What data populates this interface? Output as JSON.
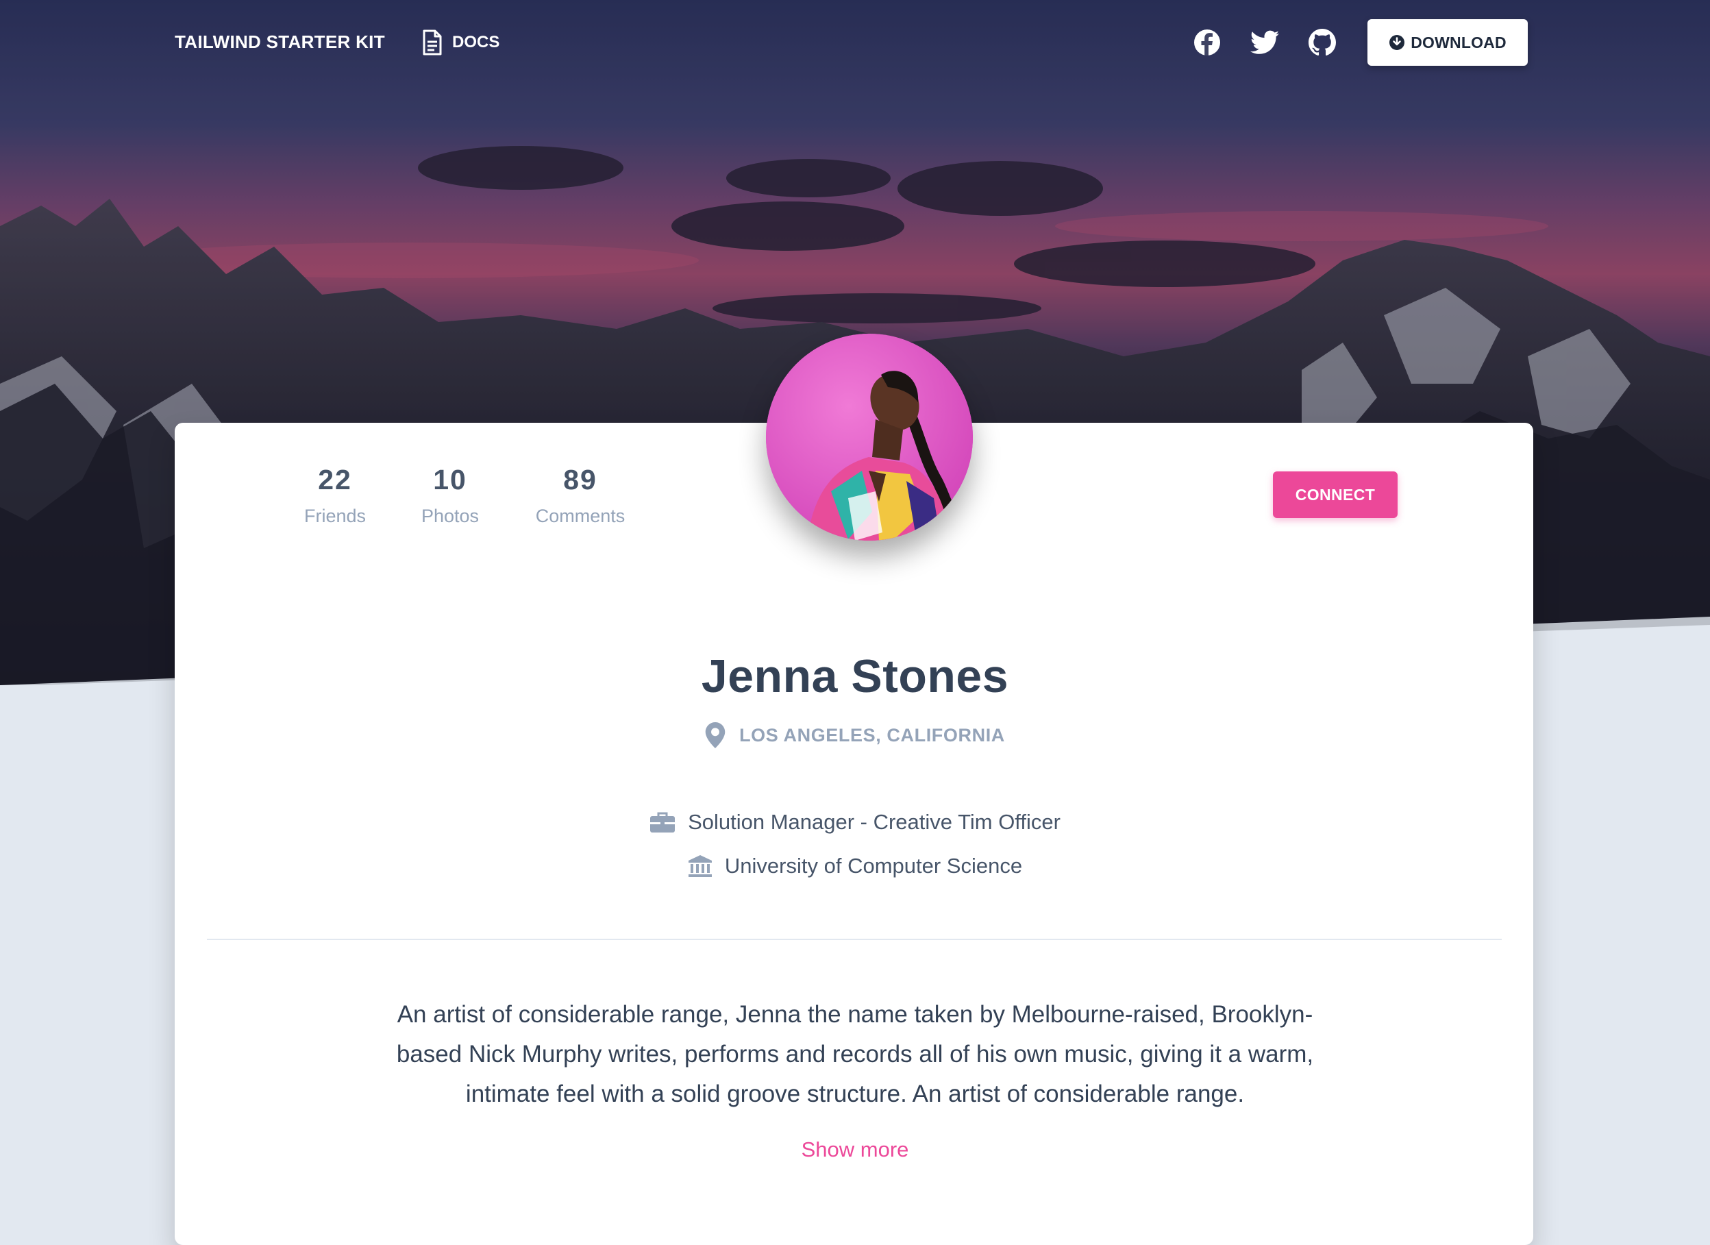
{
  "navbar": {
    "brand": "TAILWIND STARTER KIT",
    "docs_label": "DOCS",
    "social": [
      "facebook-icon",
      "twitter-icon",
      "github-icon"
    ],
    "download_label": "DOWNLOAD"
  },
  "profile": {
    "stats": [
      {
        "value": "22",
        "label": "Friends"
      },
      {
        "value": "10",
        "label": "Photos"
      },
      {
        "value": "89",
        "label": "Comments"
      }
    ],
    "connect_label": "CONNECT",
    "name": "Jenna Stones",
    "location": "LOS ANGELES, CALIFORNIA",
    "job": "Solution Manager - Creative Tim Officer",
    "education": "University of Computer Science",
    "bio": "An artist of considerable range, Jenna the name taken by Melbourne-raised, Brooklyn-based Nick Murphy writes, performs and records all of his own music, giving it a warm, intimate feel with a solid groove structure. An artist of considerable range.",
    "show_more": "Show more"
  },
  "colors": {
    "accent": "#ec4899",
    "page_bg": "#e2e8f0",
    "heading": "#334155",
    "muted": "#94a3b8"
  }
}
